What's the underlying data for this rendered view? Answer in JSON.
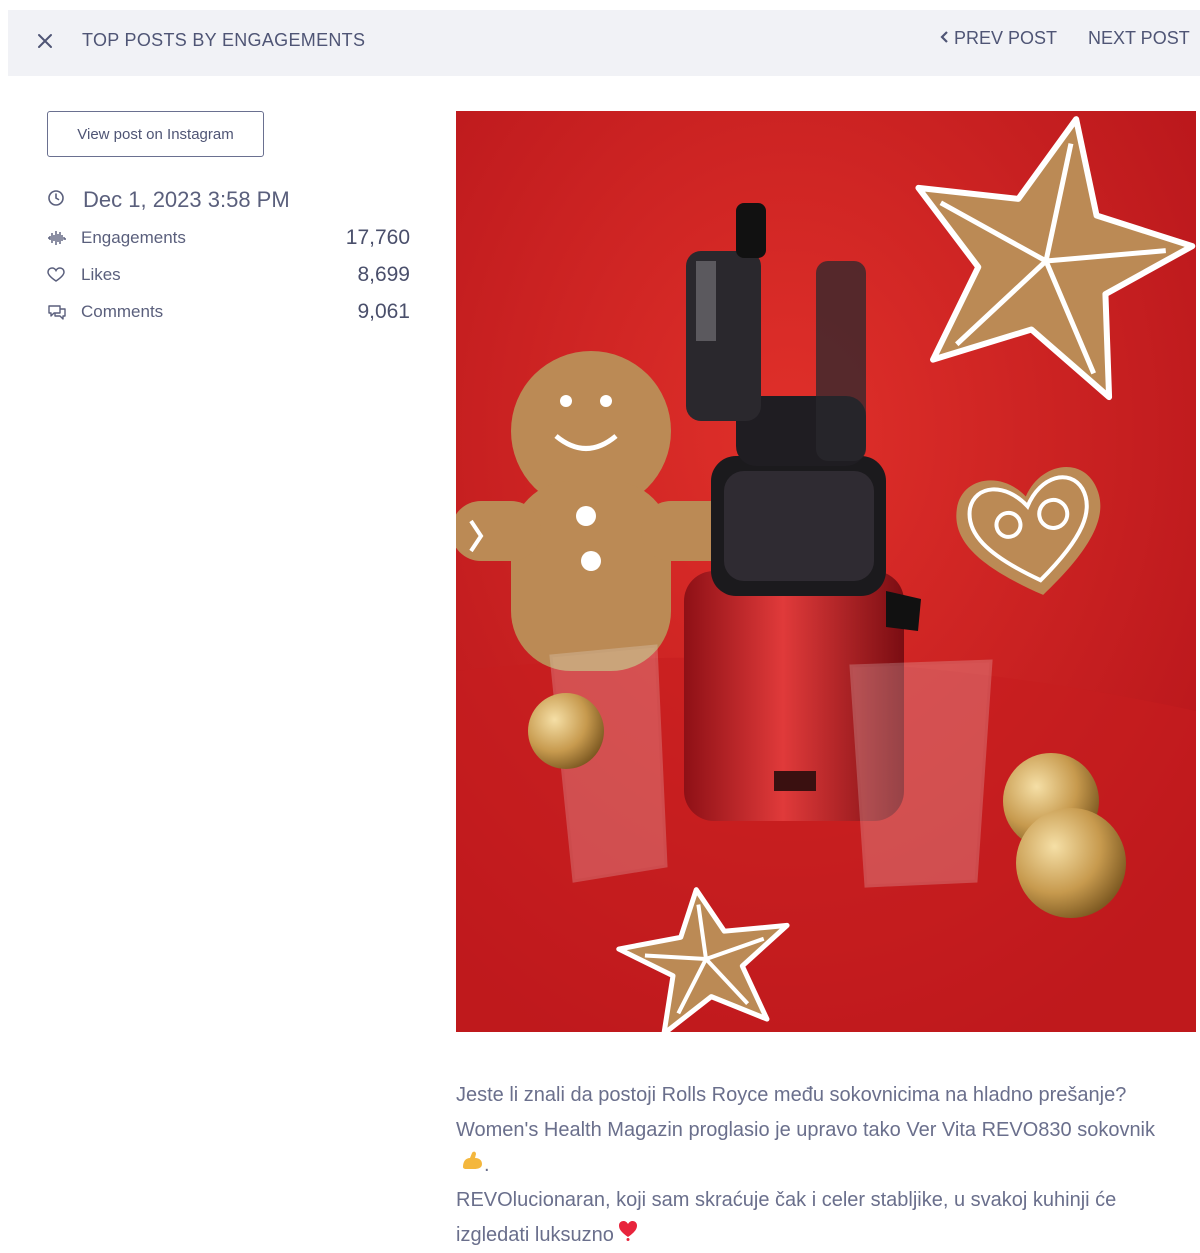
{
  "header": {
    "title": "TOP POSTS BY ENGAGEMENTS",
    "prev_label": "PREV POST",
    "next_label": "NEXT POST"
  },
  "sidebar": {
    "view_button": "View post on Instagram",
    "date": "Dec 1, 2023 3:58 PM",
    "stats": [
      {
        "label": "Engagements",
        "value": "17,760",
        "icon": "waveform-icon"
      },
      {
        "label": "Likes",
        "value": "8,699",
        "icon": "heart-icon"
      },
      {
        "label": "Comments",
        "value": "9,061",
        "icon": "comment-icon"
      }
    ]
  },
  "post": {
    "caption_line1": "Jeste li znali da postoji Rolls Royce među sokovnicima na hladno prešanje? Women's Health Magazin proglasio je upravo tako Ver Vita REVO830 sokovnik",
    "caption_line2": "REVOlucionaran, koji sam skraćuje čak i celer stabljike, u svakoj kuhinji će izgledati luksuzno"
  },
  "colors": {
    "topbar_bg": "#f1f2f6",
    "text": "#4f5575",
    "photo_bg": "#d21d1d",
    "heart_emoji": "#e8243c"
  }
}
